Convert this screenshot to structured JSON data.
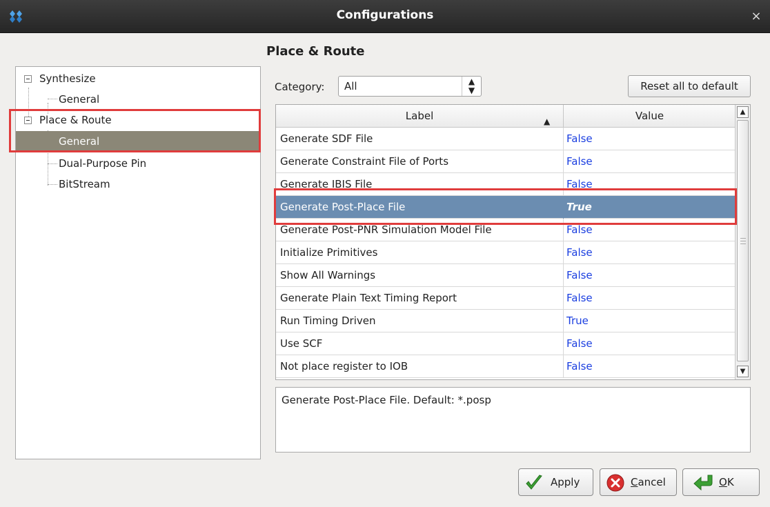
{
  "window": {
    "title": "Configurations",
    "close_glyph": "×"
  },
  "page_title": "Place & Route",
  "tree": {
    "items": [
      {
        "label": "Synthesize",
        "level": 0,
        "expanded": true
      },
      {
        "label": "General",
        "level": 1
      },
      {
        "label": "Place & Route",
        "level": 0,
        "expanded": true
      },
      {
        "label": "General",
        "level": 1,
        "selected": true
      },
      {
        "label": "Dual-Purpose Pin",
        "level": 1
      },
      {
        "label": "BitStream",
        "level": 1
      }
    ]
  },
  "category": {
    "label": "Category:",
    "selected": "All"
  },
  "reset_button": "Reset all to default",
  "table": {
    "headers": {
      "label": "Label",
      "value": "Value"
    },
    "rows": [
      {
        "label": "Generate SDF File",
        "value": "False"
      },
      {
        "label": "Generate Constraint File of Ports",
        "value": "False"
      },
      {
        "label": "Generate IBIS File",
        "value": "False"
      },
      {
        "label": "Generate Post-Place File",
        "value": "True",
        "selected": true
      },
      {
        "label": "Generate Post-PNR Simulation Model File",
        "value": "False"
      },
      {
        "label": "Initialize Primitives",
        "value": "False"
      },
      {
        "label": "Show All Warnings",
        "value": "False"
      },
      {
        "label": "Generate Plain Text Timing Report",
        "value": "False"
      },
      {
        "label": "Run Timing Driven",
        "value": "True"
      },
      {
        "label": "Use SCF",
        "value": "False"
      },
      {
        "label": "Not place register to IOB",
        "value": "False"
      }
    ]
  },
  "description": "Generate Post-Place File. Default: *.posp",
  "buttons": {
    "apply": {
      "label": "Apply",
      "icon": "check-icon"
    },
    "cancel": {
      "label_mnemonic": "C",
      "label_rest": "ancel",
      "icon": "cancel-icon"
    },
    "ok": {
      "label_mnemonic": "O",
      "label_rest": "K",
      "icon": "ok-arrow-icon"
    }
  },
  "colors": {
    "highlight_box": "#e03c3c",
    "tree_selected": "#8b8777",
    "row_selected": "#6b8db1",
    "value_text": "#1a3ee0"
  }
}
